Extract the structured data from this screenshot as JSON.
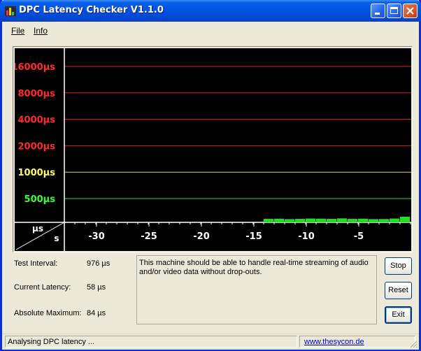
{
  "window": {
    "title": "DPC Latency Checker V1.1.0"
  },
  "menu": {
    "file": "File",
    "info": "Info"
  },
  "graph": {
    "y_ticks": [
      {
        "label": "16000µs",
        "value": 16000,
        "color": "#ff2a2a"
      },
      {
        "label": "8000µs",
        "value": 8000,
        "color": "#ff2a2a"
      },
      {
        "label": "4000µs",
        "value": 4000,
        "color": "#ff2a2a"
      },
      {
        "label": "2000µs",
        "value": 2000,
        "color": "#ff2a2a"
      },
      {
        "label": "1000µs",
        "value": 1000,
        "color": "#ffff66"
      },
      {
        "label": "500µs",
        "value": 500,
        "color": "#33ff33"
      }
    ],
    "y_axis_unit": "µs",
    "x_axis_unit": "s",
    "x_ticks": [
      "-30",
      "-25",
      "-20",
      "-15",
      "-10",
      "-5"
    ],
    "bar_color": "#22dd22",
    "bars": [
      58,
      60,
      55,
      58,
      62,
      60,
      58,
      64,
      58,
      60,
      55,
      56,
      62,
      84
    ]
  },
  "stats": {
    "test_interval_label": "Test Interval:",
    "test_interval_value": "976 µs",
    "current_latency_label": "Current Latency:",
    "current_latency_value": "58 µs",
    "absolute_maximum_label": "Absolute Maximum:",
    "absolute_maximum_value": "84 µs"
  },
  "message": "This machine should be able to handle real-time streaming of audio and/or video data without drop-outs.",
  "buttons": {
    "stop": "Stop",
    "reset": "Reset",
    "exit": "Exit"
  },
  "status": {
    "text": "Analysing DPC latency ...",
    "link": "www.thesycon.de"
  }
}
